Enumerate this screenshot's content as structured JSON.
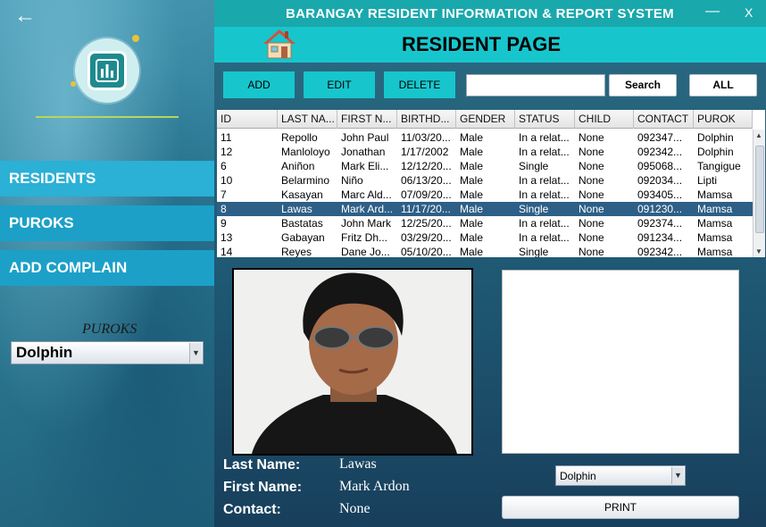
{
  "window": {
    "title": "BARANGAY RESIDENT INFORMATION  & REPORT SYSTEM",
    "minimize": "—",
    "close": "X"
  },
  "page": {
    "title": "RESIDENT PAGE",
    "icon": "house-icon"
  },
  "sidebar": {
    "back": "←",
    "logo_icon": "bar-chart-icon",
    "nav": {
      "residents": "RESIDENTS",
      "puroks": "PUROKS",
      "add_complain": "ADD COMPLAIN"
    },
    "purok_label": "PUROKS",
    "purok_selected": "Dolphin"
  },
  "toolbar": {
    "add": "ADD",
    "edit": "EDIT",
    "delete": "DELETE",
    "search_value": "",
    "search": "Search",
    "all": "ALL"
  },
  "table": {
    "columns": [
      "ID",
      "LAST NA...",
      "FIRST N...",
      "BIRTHD...",
      "GENDER",
      "STATUS",
      "CHILD",
      "CONTACT",
      "PUROK"
    ],
    "rows": [
      [
        "11",
        "Repollo",
        "John Paul",
        "11/03/20...",
        "Male",
        "In a relat...",
        "None",
        "092347...",
        "Dolphin"
      ],
      [
        "12",
        "Manloloyo",
        "Jonathan",
        "1/17/2002",
        "Male",
        "In a relat...",
        "None",
        "092342...",
        "Dolphin"
      ],
      [
        "6",
        "Aniñon",
        "Mark Eli...",
        "12/12/20...",
        "Male",
        "Single",
        "None",
        "095068...",
        "Tangigue"
      ],
      [
        "10",
        "Belarmino",
        "Niño",
        "06/13/20...",
        "Male",
        "In a relat...",
        "None",
        "092034...",
        "Lipti"
      ],
      [
        "7",
        "Kasayan",
        "Marc Ald...",
        "07/09/20...",
        "Male",
        "In a relat...",
        "None",
        "093405...",
        "Mamsa"
      ],
      [
        "8",
        "Lawas",
        "Mark Ard...",
        "11/17/20...",
        "Male",
        "Single",
        "None",
        "091230...",
        "Mamsa"
      ],
      [
        "9",
        "Bastatas",
        "John Mark",
        "12/25/20...",
        "Male",
        "In a relat...",
        " None",
        "092374...",
        "Mamsa"
      ],
      [
        "13",
        "Gabayan",
        "Fritz Dh...",
        "03/29/20...",
        "Male",
        "In a relat...",
        "None",
        "091234...",
        "Mamsa"
      ],
      [
        "14",
        "Reyes",
        "Dane Jo...",
        "05/10/20...",
        "Male",
        "Single",
        "None",
        "092342...",
        "Mamsa"
      ]
    ],
    "selected_index": 5
  },
  "details": {
    "last_name_label": "Last Name:",
    "last_name": "Lawas",
    "first_name_label": "First Name:",
    "first_name": "Mark Ardon",
    "contact_label": "Contact:",
    "contact": "None"
  },
  "report": {
    "purok_selected": "Dolphin",
    "print": "PRINT"
  },
  "colors": {
    "accent": "#17c6cd",
    "titlebar": "#19a8ac",
    "nav_active": "#2bb0d6",
    "nav": "#1ca0c8",
    "selected_row": "#2e5f86"
  }
}
